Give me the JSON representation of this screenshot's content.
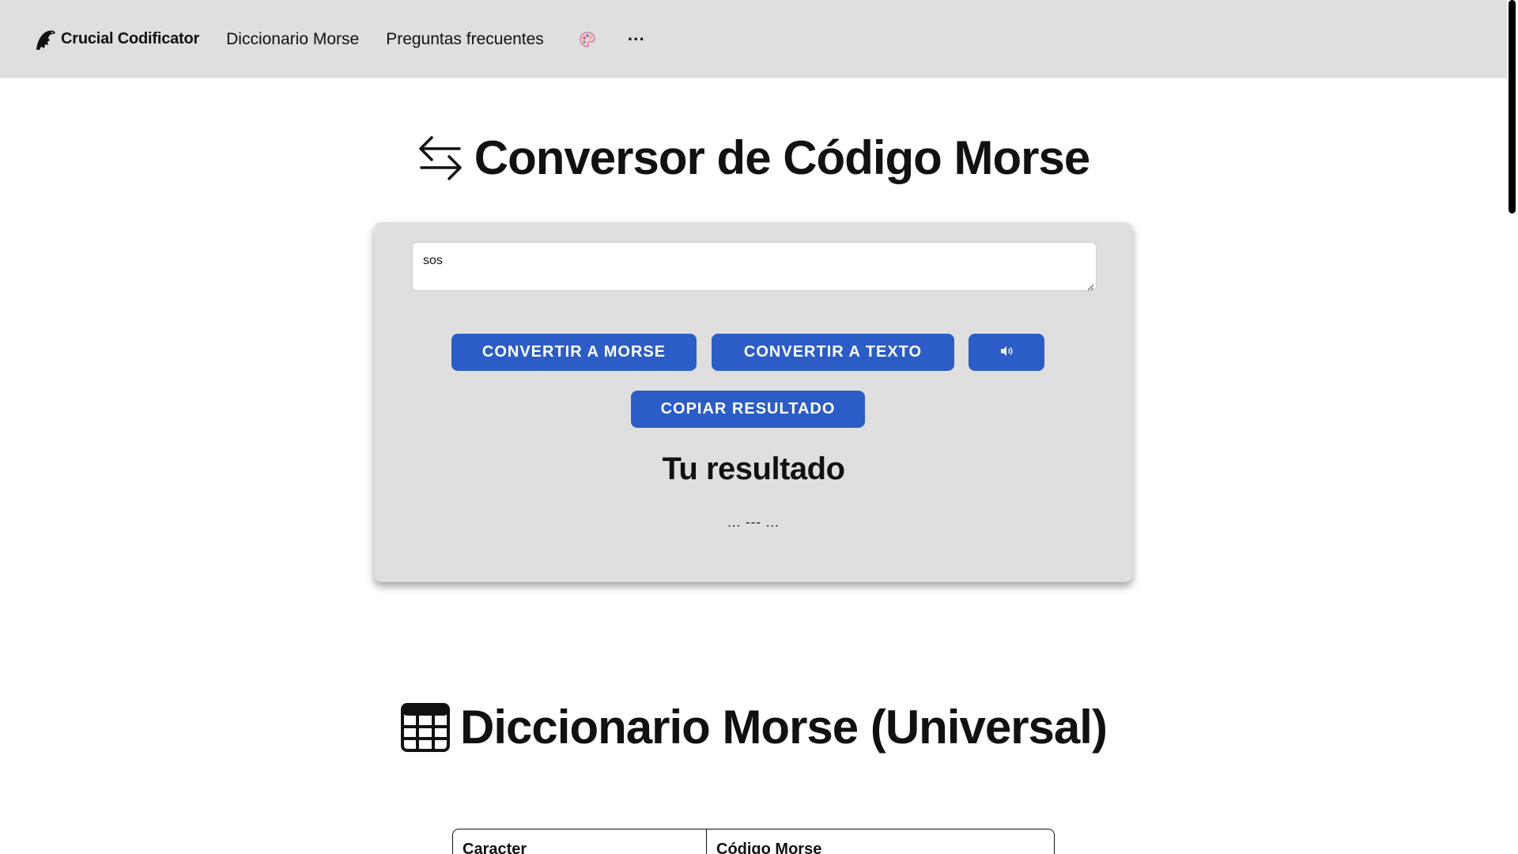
{
  "nav": {
    "brand": "Crucial Codificator",
    "links": [
      "Diccionario Morse",
      "Preguntas frecuentes"
    ],
    "palette_icon": "palette-icon",
    "more_label": "···"
  },
  "hero": {
    "title": "Conversor de Código Morse",
    "icon": "swap-arrows-icon"
  },
  "converter": {
    "input_value": "sos",
    "buttons": {
      "to_morse": "CONVERTIR A MORSE",
      "to_text": "CONVERTIR A TEXTO",
      "audio_icon": "speaker-icon",
      "copy": "COPIAR RESULTADO"
    },
    "result_title": "Tu resultado",
    "result_value": "... --- ..."
  },
  "dictionary": {
    "title": "Diccionario Morse (Universal)",
    "icon": "table-icon",
    "columns": [
      "Caracter",
      "Código Morse"
    ]
  },
  "colors": {
    "accent": "#2c5cc5",
    "nav_bg": "#dfdfdf",
    "card_bg": "#dfdfdf"
  }
}
